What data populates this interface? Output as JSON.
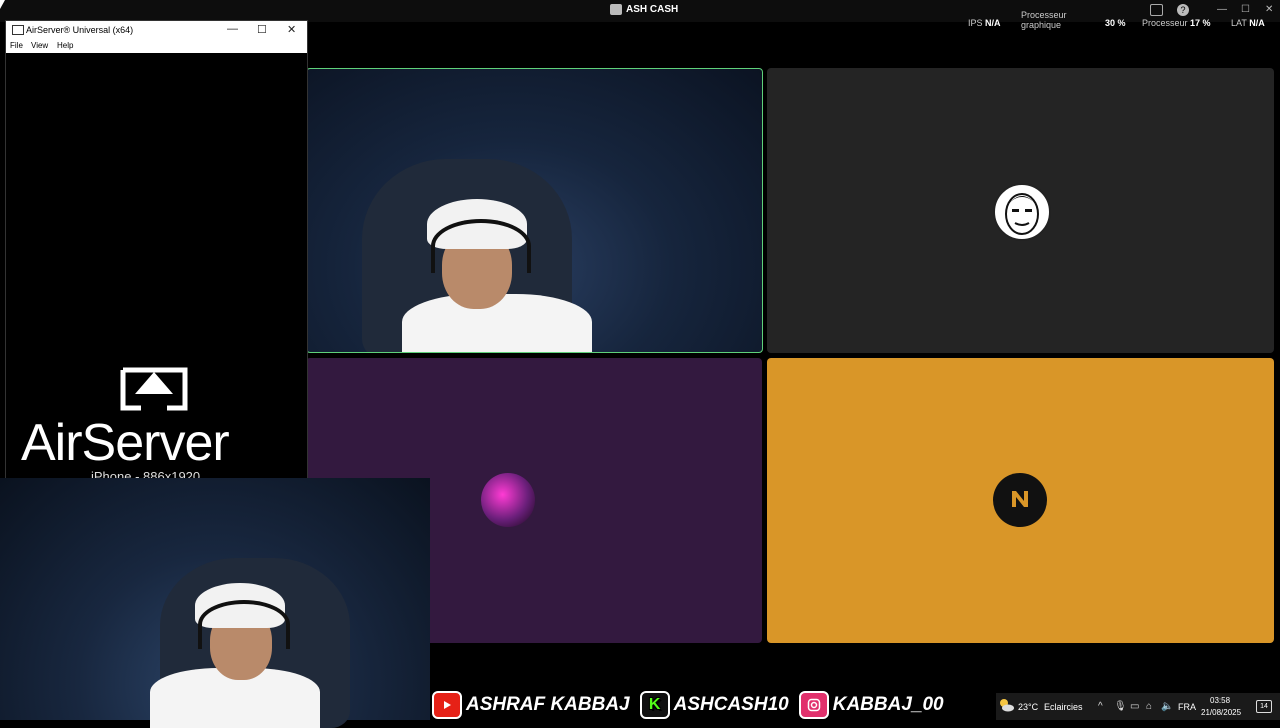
{
  "topbar": {
    "app_title": "ASH CASH",
    "ips_label": "IPS",
    "ips_value": "N/A",
    "gpu_label_line1": "Processeur",
    "gpu_label_line2": "graphique",
    "gpu_value": "30 %",
    "cpu_label": "Processeur",
    "cpu_value": "17 %",
    "lat_label": "LAT",
    "lat_value": "N/A"
  },
  "airserver": {
    "window_title": "AirServer® Universal (x64)",
    "menu": [
      "File",
      "View",
      "Help"
    ],
    "logo_text": "AirServer",
    "device_text": "iPhone - 886x1920"
  },
  "social": [
    {
      "platform": "youtube",
      "handle": "ASHRAF KABBAJ",
      "color": "#e62117"
    },
    {
      "platform": "kick",
      "handle": "ASHCASH10",
      "color": "#53fc18"
    },
    {
      "platform": "instagram",
      "handle": "KABBAJ_00",
      "color": "#e1306c"
    }
  ],
  "tray": {
    "temperature": "23°C",
    "weather": "Eclaircies",
    "language": "FRA",
    "time": "03:58",
    "date": "21/08/2025",
    "notifications": "14"
  },
  "colors": {
    "tile_active_border": "#5fd17a",
    "tile_dark": "#242424",
    "tile_purple": "#33193f",
    "tile_gold": "#d99628"
  }
}
